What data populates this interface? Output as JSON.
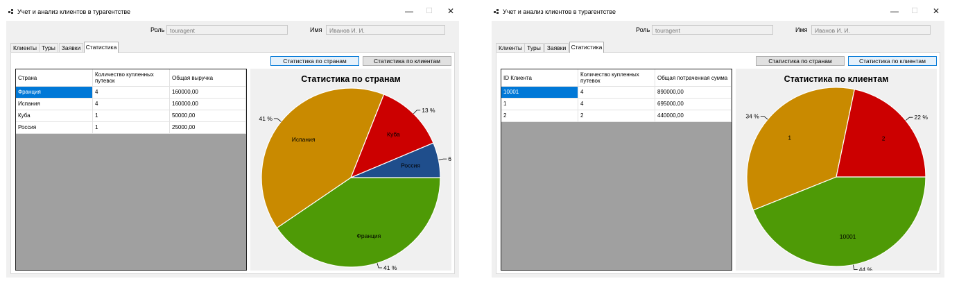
{
  "windows": [
    {
      "title": "Учет и анализ клиентов в турагентстве",
      "role_label": "Роль",
      "role_value": "touragent",
      "name_label": "Имя",
      "name_value": "Иванов И. И.",
      "tabs": [
        "Клиенты",
        "Туры",
        "Заявки",
        "Статистика"
      ],
      "active_tab": "Статистика",
      "buttons": {
        "by_countries": "Статистика по странам",
        "by_clients": "Статистика по клиентам",
        "active": "by_countries"
      },
      "table": {
        "columns": [
          "Страна",
          "Количество купленных путевок",
          "Общая выручка"
        ],
        "rows": [
          [
            "Франция",
            "4",
            "160000,00"
          ],
          [
            "Испания",
            "4",
            "160000,00"
          ],
          [
            "Куба",
            "1",
            "50000,00"
          ],
          [
            "Россия",
            "1",
            "25000,00"
          ]
        ],
        "selected_row": 0
      },
      "chart_data": {
        "type": "pie",
        "title": "Статистика по странам",
        "categories": [
          "Франция",
          "Испания",
          "Куба",
          "Россия"
        ],
        "values": [
          160000,
          160000,
          50000,
          25000
        ],
        "percent_labels": [
          "41 %",
          "41 %",
          "13 %",
          "6"
        ],
        "colors": [
          "#4e9a06",
          "#c98a00",
          "#cc0000",
          "#1f4e8c"
        ]
      }
    },
    {
      "title": "Учет и анализ клиентов в турагентстве",
      "role_label": "Роль",
      "role_value": "touragent",
      "name_label": "Имя",
      "name_value": "Иванов И. И.",
      "tabs": [
        "Клиенты",
        "Туры",
        "Заявки",
        "Статистика"
      ],
      "active_tab": "Статистика",
      "buttons": {
        "by_countries": "Статистика по странам",
        "by_clients": "Статистика по клиентам",
        "active": "by_clients"
      },
      "table": {
        "columns": [
          "ID Клиента",
          "Количество купленных путевок",
          "Общая потраченная сумма"
        ],
        "rows": [
          [
            "10001",
            "4",
            "890000,00"
          ],
          [
            "1",
            "4",
            "695000,00"
          ],
          [
            "2",
            "2",
            "440000,00"
          ]
        ],
        "selected_row": 0
      },
      "chart_data": {
        "type": "pie",
        "title": "Статистика по клиентам",
        "categories": [
          "10001",
          "1",
          "2"
        ],
        "values": [
          890000,
          695000,
          440000
        ],
        "percent_labels": [
          "44 %",
          "34 %",
          "22 %"
        ],
        "colors": [
          "#4e9a06",
          "#c98a00",
          "#cc0000"
        ]
      }
    }
  ]
}
